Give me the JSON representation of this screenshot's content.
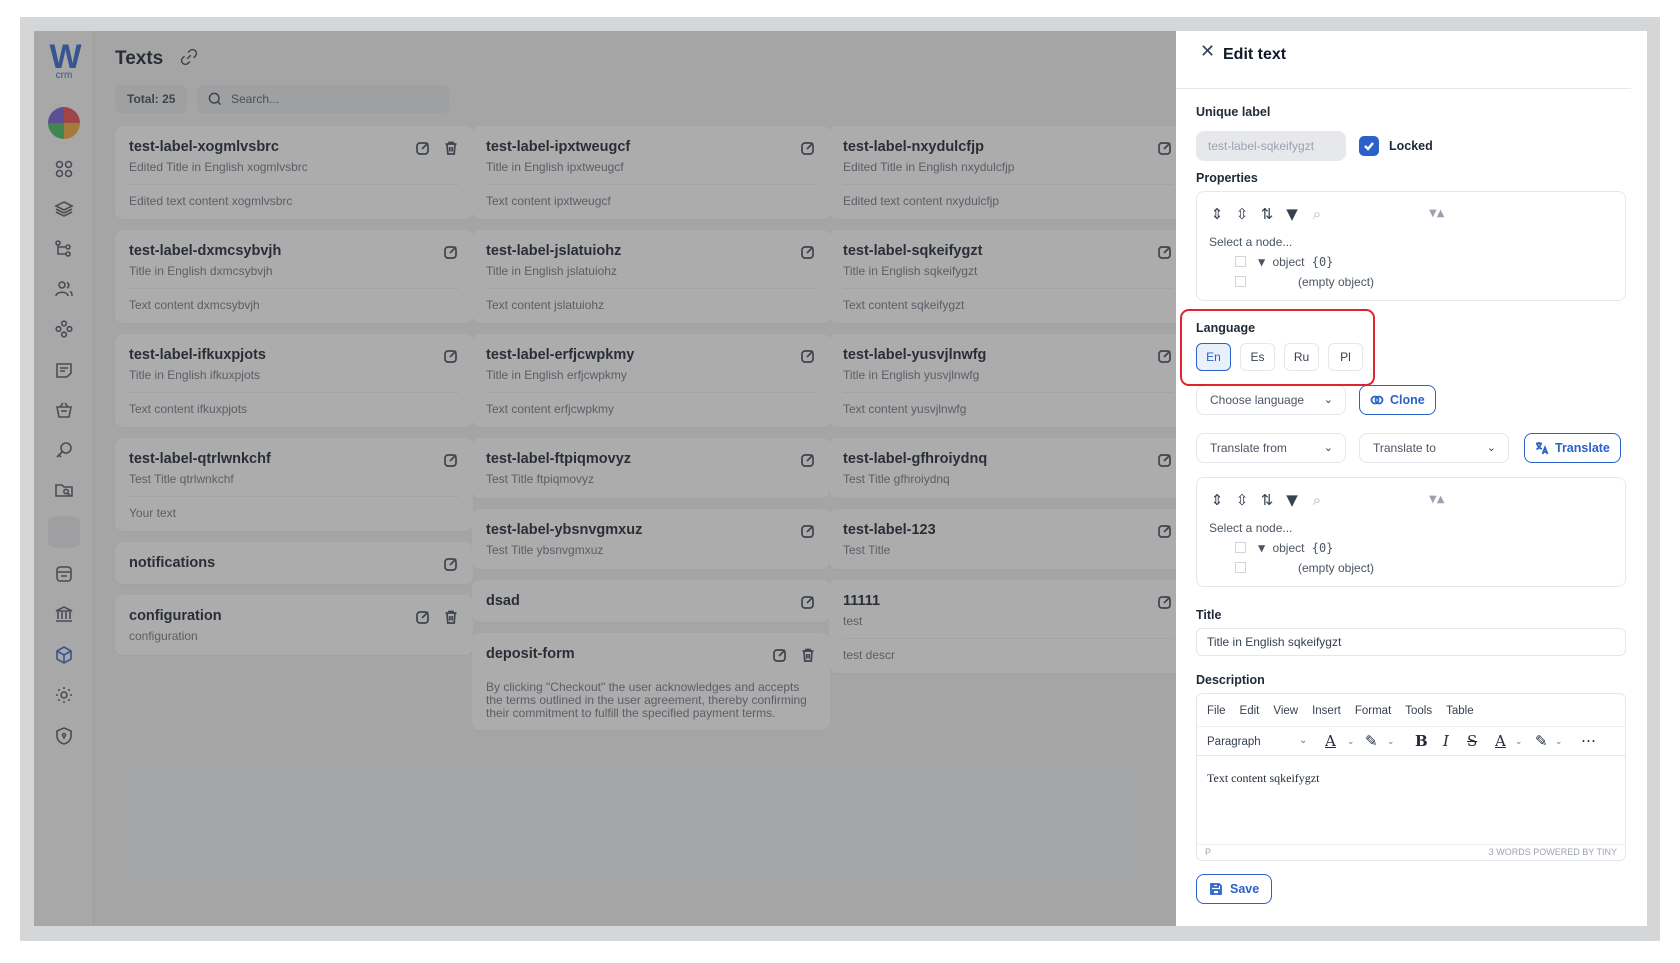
{
  "app": {
    "logo_letter": "W",
    "logo_sub": "crm",
    "page_title": "Texts",
    "total_label": "Total: 25",
    "search_placeholder": "Search..."
  },
  "sidebar": {
    "items": [
      {
        "icon": "grid-icon"
      },
      {
        "icon": "layers-icon"
      },
      {
        "icon": "hierarchy-icon"
      },
      {
        "icon": "users-icon"
      },
      {
        "icon": "group-icon"
      },
      {
        "icon": "chat-note-icon"
      },
      {
        "icon": "basket-icon"
      },
      {
        "icon": "key-icon"
      },
      {
        "icon": "folder-search-icon"
      },
      {
        "icon": "blank-icon"
      },
      {
        "icon": "inbox-icon"
      },
      {
        "icon": "bank-icon"
      },
      {
        "icon": "cube-icon",
        "active": true
      },
      {
        "icon": "settings-icon"
      },
      {
        "icon": "shield-icon"
      }
    ]
  },
  "cards": {
    "col1": [
      {
        "label": "test-label-xogmlvsbrc",
        "title": "Edited Title in English xogmlvsbrc",
        "content": "Edited text content xogmlvsbrc",
        "delete": true
      },
      {
        "label": "test-label-dxmcsybvjh",
        "title": "Title in English dxmcsybvjh",
        "content": "Text content dxmcsybvjh"
      },
      {
        "label": "test-label-ifkuxpjots",
        "title": "Title in English ifkuxpjots",
        "content": "Text content ifkuxpjots"
      },
      {
        "label": "test-label-qtrlwnkchf",
        "title": "Test Title qtrlwnkchf",
        "content": "Your text"
      },
      {
        "label": "notifications"
      },
      {
        "label": "configuration",
        "title": "configuration",
        "delete": true
      }
    ],
    "col2": [
      {
        "label": "test-label-ipxtweugcf",
        "title": "Title in English ipxtweugcf",
        "content": "Text content ipxtweugcf"
      },
      {
        "label": "test-label-jslatuiohz",
        "title": "Title in English jslatuiohz",
        "content": "Text content jslatuiohz"
      },
      {
        "label": "test-label-erfjcwpkmy",
        "title": "Title in English erfjcwpkmy",
        "content": "Text content erfjcwpkmy"
      },
      {
        "label": "test-label-ftpiqmovyz",
        "title": "Test Title ftpiqmovyz"
      },
      {
        "label": "test-label-ybsnvgmxuz",
        "title": "Test Title ybsnvgmxuz"
      },
      {
        "label": "dsad"
      },
      {
        "label": "deposit-form",
        "long": "By clicking \"Checkout\" the user acknowledges and accepts the terms outlined in the user agreement, thereby confirming their commitment to fulfill the specified payment terms.",
        "delete": true
      }
    ],
    "col3": [
      {
        "label": "test-label-nxydulcfjp",
        "title": "Edited Title in English nxydulcfjp",
        "content": "Edited text content nxydulcfjp"
      },
      {
        "label": "test-label-sqkeifygzt",
        "title": "Title in English sqkeifygzt",
        "content": "Text content sqkeifygzt"
      },
      {
        "label": "test-label-yusvjlnwfg",
        "title": "Title in English yusvjlnwfg",
        "content": "Text content yusvjlnwfg"
      },
      {
        "label": "test-label-gfhroiydnq",
        "title": "Test Title gfhroiydnq"
      },
      {
        "label": "test-label-123",
        "title": "Test Title"
      },
      {
        "label": "11111",
        "title": "test",
        "content": "test descr"
      }
    ]
  },
  "panel": {
    "title": "Edit text",
    "unique_label_heading": "Unique label",
    "unique_label_value": "test-label-sqkeifygzt",
    "locked_label": "Locked",
    "properties_heading": "Properties",
    "json_select": "Select a node...",
    "json_object": "object",
    "json_count": "{0}",
    "json_empty": "(empty object)",
    "language_heading": "Language",
    "languages": [
      "En",
      "Es",
      "Ru",
      "Pl"
    ],
    "active_language": "En",
    "choose_language": "Choose language",
    "clone": "Clone",
    "translate_from": "Translate from",
    "translate_to": "Translate to",
    "translate": "Translate",
    "title_heading": "Title",
    "title_value": "Title in English sqkeifygzt",
    "description_heading": "Description",
    "menu": [
      "File",
      "Edit",
      "View",
      "Insert",
      "Format",
      "Tools",
      "Table"
    ],
    "paragraph": "Paragraph",
    "editor_text": "Text content sqkeifygzt",
    "status_left": "P",
    "status_right": "3 WORDS  POWERED BY TINY",
    "save": "Save"
  }
}
